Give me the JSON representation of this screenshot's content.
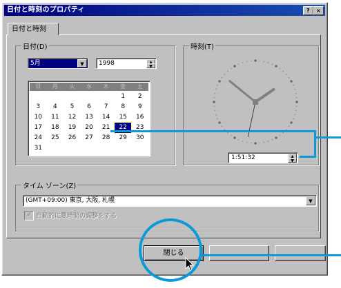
{
  "window": {
    "title": "日付と時刻のプロパティ",
    "help_button": "?",
    "close_button": "×"
  },
  "tabs": [
    {
      "label": "日付と時刻",
      "active": true
    }
  ],
  "date_group": {
    "label": "日付(D)",
    "month_select": {
      "value": "5月"
    },
    "year_spinner": {
      "value": "1998"
    },
    "weekday_headers": [
      "日",
      "月",
      "火",
      "水",
      "木",
      "金",
      "土"
    ],
    "weeks": [
      [
        "",
        "",
        "",
        "",
        "",
        "1",
        "2"
      ],
      [
        "3",
        "4",
        "5",
        "6",
        "7",
        "8",
        "9"
      ],
      [
        "10",
        "11",
        "12",
        "13",
        "14",
        "15",
        "16"
      ],
      [
        "17",
        "18",
        "19",
        "20",
        "21",
        "22",
        "23"
      ],
      [
        "24",
        "25",
        "26",
        "27",
        "28",
        "29",
        "30"
      ],
      [
        "31",
        "",
        "",
        "",
        "",
        "",
        ""
      ]
    ],
    "selected_day": "22"
  },
  "time_group": {
    "label": "時刻(T)",
    "clock": {
      "hour": 1,
      "minute": 51,
      "second": 32
    },
    "time_spinner": {
      "value": "1:51:32"
    }
  },
  "timezone": {
    "label": "タイム ゾーン(Z)",
    "value": "(GMT+09:00) 東京, 大阪, 札幌"
  },
  "dst_checkbox": {
    "label": "自動的に夏時間の調整をする",
    "checked": true,
    "enabled": false
  },
  "buttons": {
    "close": "閉じる",
    "cancel": "",
    "apply": ""
  },
  "colors": {
    "callout": "#0a9ad8",
    "titlebar": "#000080",
    "face": "#c0c0c0"
  }
}
